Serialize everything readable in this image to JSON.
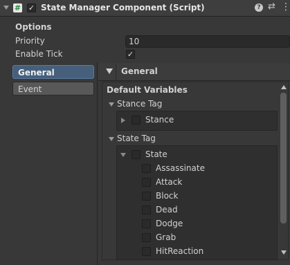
{
  "header": {
    "title": "State Manager Component (Script)",
    "enabled": true,
    "script_icon": "hash-script-icon",
    "buttons": [
      "help-icon",
      "preset-icon",
      "kebab-menu-icon"
    ]
  },
  "options": {
    "section_label": "Options",
    "priority_label": "Priority",
    "priority_value": "10",
    "enable_tick_label": "Enable Tick",
    "enable_tick": true
  },
  "tabs": [
    {
      "label": "General",
      "selected": true
    },
    {
      "label": "Event",
      "selected": false
    }
  ],
  "panel": {
    "title": "General",
    "default_variables_label": "Default Variables",
    "stance_tag": {
      "label": "Stance Tag",
      "item_label": "Stance"
    },
    "state_tag": {
      "label": "State Tag",
      "root_label": "State",
      "children": [
        "Assassinate",
        "Attack",
        "Block",
        "Dead",
        "Dodge",
        "Grab",
        "HitReaction"
      ]
    }
  },
  "colors": {
    "selected_tab": "#46607c",
    "header_bg": "#3e3e3e",
    "panel_bg": "#383838"
  }
}
